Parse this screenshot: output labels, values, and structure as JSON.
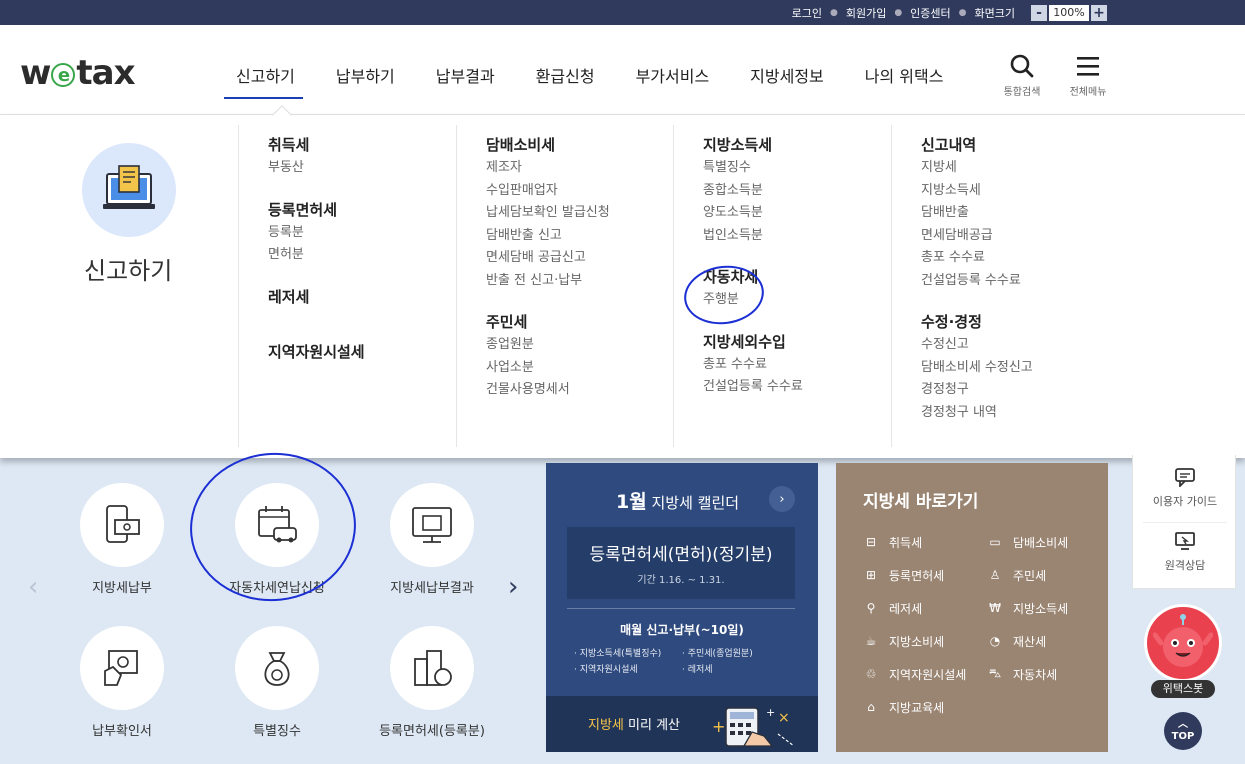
{
  "topbar": {
    "login": "로그인",
    "signup": "회원가입",
    "cert": "인증센터",
    "screen_size": "화면크기",
    "zoom_minus": "-",
    "zoom_value": "100%",
    "zoom_plus": "+"
  },
  "header": {
    "logo_w": "w",
    "logo_e": "e",
    "logo_tax": "tax",
    "nav": [
      "신고하기",
      "납부하기",
      "납부결과",
      "환급신청",
      "부가서비스",
      "지방세정보",
      "나의 위택스"
    ],
    "search_label": "통합검색",
    "menu_label": "전체메뉴"
  },
  "mega": {
    "title": "신고하기",
    "col1": {
      "h1": "취득세",
      "h1_items": [
        "부동산"
      ],
      "h2": "등록면허세",
      "h2_items": [
        "등록분",
        "면허분"
      ],
      "h3": "레저세",
      "h4": "지역자원시설세"
    },
    "col2": {
      "h1": "담배소비세",
      "h1_items": [
        "제조자",
        "수입판매업자",
        "납세담보확인 발급신청",
        "담배반출 신고",
        "면세담배 공급신고",
        "반출 전 신고·납부"
      ],
      "h2": "주민세",
      "h2_items": [
        "종업원분",
        "사업소분",
        "건물사용명세서"
      ]
    },
    "col3": {
      "h1": "지방소득세",
      "h1_items": [
        "특별징수",
        "종합소득분",
        "양도소득분",
        "법인소득분"
      ],
      "h2": "자동차세",
      "h2_items": [
        "주행분"
      ],
      "h3": "지방세외수입",
      "h3_items": [
        "총포 수수료",
        "건설업등록 수수료"
      ]
    },
    "col4": {
      "h1": "신고내역",
      "h1_items": [
        "지방세",
        "지방소득세",
        "담배반출",
        "면세담배공급",
        "총포 수수료",
        "건설업등록 수수료"
      ],
      "h2": "수정·경정",
      "h2_items": [
        "수정신고",
        "담배소비세 수정신고",
        "경정청구",
        "경정청구 내역"
      ]
    }
  },
  "quick": {
    "items": [
      "지방세납부",
      "자동차세연납신청",
      "지방세납부결과",
      "납부확인서",
      "특별징수",
      "등록면허세(등록분)"
    ],
    "prev": "‹",
    "next": "›"
  },
  "calendar": {
    "month": "1월",
    "title": " 지방세 캘린더",
    "next": "›",
    "event_title": "등록면허세(면허)(정기분)",
    "event_period": "기간 1.16. ~ 1.31.",
    "monthly_title": "매월 신고·납부(~10일)",
    "monthly_items": [
      "· 지방소득세(특별징수)",
      "· 주민세(종업원분)",
      "· 지역자원시설세",
      "· 레저세"
    ],
    "calc_highlight": "지방세",
    "calc_rest": " 미리 계산"
  },
  "shortcut": {
    "title": "지방세 바로가기",
    "items": [
      {
        "label": "취득세",
        "icon": "building-icon"
      },
      {
        "label": "담배소비세",
        "icon": "cigarette-icon"
      },
      {
        "label": "등록면허세",
        "icon": "license-icon"
      },
      {
        "label": "주민세",
        "icon": "person-icon"
      },
      {
        "label": "레저세",
        "icon": "bicycle-icon"
      },
      {
        "label": "지방소득세",
        "icon": "coin-icon"
      },
      {
        "label": "지방소비세",
        "icon": "cup-icon"
      },
      {
        "label": "재산세",
        "icon": "pie-icon"
      },
      {
        "label": "지역자원시설세",
        "icon": "recycle-icon"
      },
      {
        "label": "자동차세",
        "icon": "car-icon"
      },
      {
        "label": "지방교육세",
        "icon": "graduation-icon"
      }
    ]
  },
  "side": {
    "guide": "이용자 가이드",
    "remote": "원격상담",
    "bot": "위택스봇",
    "top": "TOP"
  },
  "colors": {
    "topbar": "#2f3a5c",
    "accent": "#1a3fb0",
    "calendar": "#2f4a7e",
    "shortcut": "#9a8573",
    "bot": "#e9414e",
    "annotation": "#1b2fd4"
  }
}
